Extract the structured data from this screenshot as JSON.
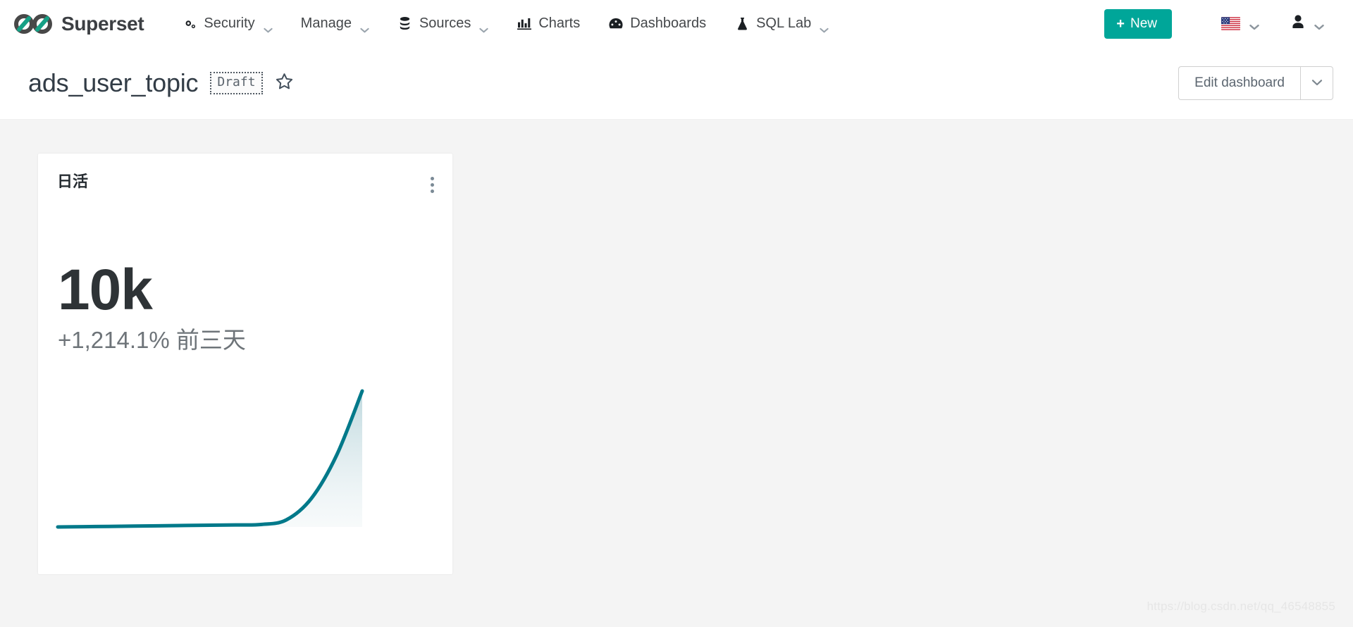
{
  "navbar": {
    "brand": {
      "name": "Superset",
      "logo_icon": "superset-infinity-logo"
    },
    "items": [
      {
        "label": "Security",
        "icon": "gears-icon",
        "has_dropdown": true
      },
      {
        "label": "Manage",
        "icon": null,
        "has_dropdown": true
      },
      {
        "label": "Sources",
        "icon": "database-stack-icon",
        "has_dropdown": true
      },
      {
        "label": "Charts",
        "icon": "bar-chart-icon",
        "has_dropdown": false
      },
      {
        "label": "Dashboards",
        "icon": "dashboard-gauge-icon",
        "has_dropdown": false
      },
      {
        "label": "SQL Lab",
        "icon": "flask-icon",
        "has_dropdown": true
      }
    ],
    "new_button": {
      "label": "New",
      "plus": "+",
      "color": "#00a699"
    },
    "language": {
      "icon": "us-flag-icon",
      "has_dropdown": true
    },
    "user": {
      "icon": "user-avatar-icon",
      "has_dropdown": true
    }
  },
  "dashboard_header": {
    "title": "ads_user_topic",
    "status_badge": "Draft",
    "favorite_icon": "star-outline-icon",
    "edit_button": "Edit dashboard",
    "edit_dropdown_icon": "chevron-down-icon"
  },
  "chart_card": {
    "title": "日活",
    "menu_icon": "kebab-menu-icon",
    "big_number": "10k",
    "subheader": "+1,214.1% 前三天"
  },
  "watermark": "https://blog.csdn.net/qq_46548855",
  "chart_data": {
    "type": "line",
    "title": "日活",
    "big_number": "10k",
    "percent_change": "+1,214.1%",
    "comparison_period": "前三天",
    "xlabel": "",
    "ylabel": "",
    "line_color": "#00798a",
    "fill": true,
    "fill_color": "#cfe2e6",
    "grid": false,
    "legend": "none",
    "x": [
      0,
      1,
      2,
      3,
      4,
      5,
      6,
      7,
      8,
      9,
      10,
      11,
      12
    ],
    "values": [
      620,
      640,
      660,
      680,
      700,
      720,
      740,
      760,
      790,
      1100,
      2600,
      5600,
      10000
    ],
    "ylim": [
      0,
      10500
    ]
  }
}
